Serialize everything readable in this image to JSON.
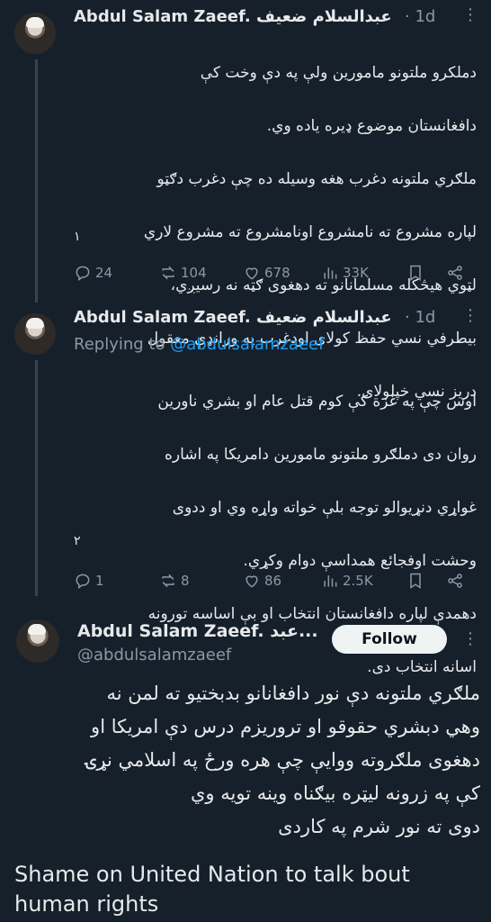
{
  "tweet1": {
    "author": "Abdul Salam Zaeef. عبدالسلام ضعيف",
    "time": "· 1d",
    "more": "⋮",
    "body_lines": [
      "دملکرو ملتونو مامورین ولې په دې وخت کې",
      "دافغانستان موضوع ډیره یاده وي.",
      "ملګري ملتونه دغرب هغه وسیله ده چې دغرب دګټو",
      "لپاره مشروع ته نامشروع اونامشروع ته مشروع لاري",
      "لټوي هیڅکله مسلمانانو ته دهغوی ګټه نه رسیږي،",
      "بیطرفي نسي حفظ کولای اودغرب په ورانډې معقول",
      "دریز نسي خپلولای."
    ],
    "number": "۱",
    "stats": {
      "replies": "24",
      "retweets": "104",
      "likes": "678",
      "views": "33K"
    }
  },
  "tweet2": {
    "author": "Abdul Salam Zaeef. عبدالسلام ضعيف",
    "time": "· 1d",
    "more": "⋮",
    "replying_prefix": "Replying to",
    "replying_handle": "@abdulsalamzaeef",
    "body_lines": [
      "اوس چې په غزة کې کوم قتل عام  او بشري ناورین",
      "روان دی دملګرو ملتونو مامورین دامریکا په اشاره",
      "غواړي دنړیوالو توجه بلې خواته واړه وي او ددوی",
      "وحشت اوفجائع همداسې دوام وکړي.",
      "دهمدې لپاره دافغانستان انتخاب او بې اساسه تورونه",
      "اسانه انتخاب دی."
    ],
    "number": "۲",
    "stats": {
      "replies": "1",
      "retweets": "8",
      "likes": "86",
      "views": "2.5K"
    }
  },
  "tweet3": {
    "author": "Abdul Salam Zaeef. عبد...",
    "handle": "@abdulsalamzaeef",
    "follow_label": "Follow",
    "more": "⋮",
    "body_lines": [
      "ملګري ملتونه دې نور دافغانانو بدبختیو ته لمن نه",
      "وهي دبشري حقوقو  او تروریزم درس دې امریکا او",
      "دهغوی ملګروته ووایې چې هره ورځ په اسلامي نړۍ",
      "کې په زرونه لیټره بیګناه وینه تویه وي",
      "دوی ته نور شرم په کاردی"
    ]
  },
  "caption": "Shame on United Nation to talk bout human rights",
  "colors": {
    "background": "#15202b",
    "text": "#e7e9ea",
    "muted": "#8b98a5",
    "link": "#1d9bf0"
  }
}
